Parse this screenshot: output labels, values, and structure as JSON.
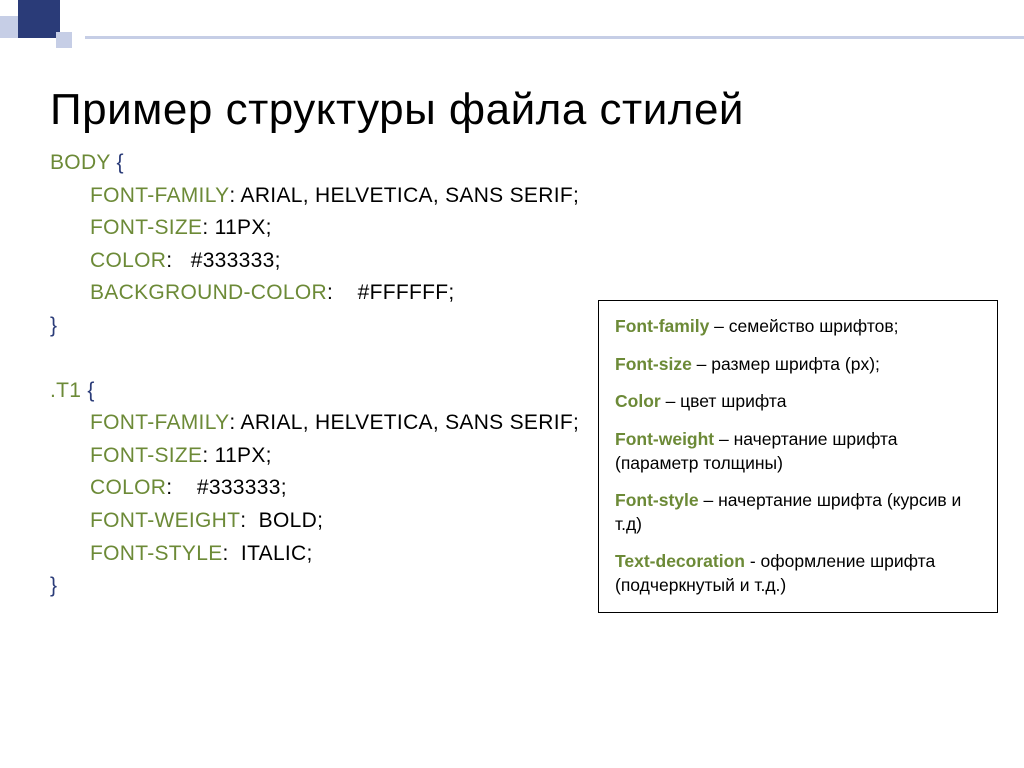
{
  "title": "Пример структуры файла стилей",
  "code": {
    "b1_sel": "Body",
    "b1_p1": "font-family",
    "b1_v1": ": Arial, Helvetica, sans serif;",
    "b1_p2": "font-size",
    "b1_v2": ": 11px;",
    "b1_p3": "color",
    "b1_v3": ":   #333333;",
    "b1_p4": "background-color",
    "b1_v4": ":    #FFFFFF;",
    "b2_sel": ".T1",
    "b2_p1": "font-family",
    "b2_v1": ": Arial, Helvetica, sans serif;",
    "b2_p2": "font-size",
    "b2_v2": ": 11px;",
    "b2_p3": "color",
    "b2_v3": ":    #333333;",
    "b2_p4": "font-weight",
    "b2_v4": ":  Bold;",
    "b2_p5": "font-style",
    "b2_v5": ":  Italic;",
    "open": " {",
    "close": "}"
  },
  "legend": [
    {
      "term": "Font-family",
      "desc": " – семейство шрифтов;"
    },
    {
      "term": "Font-size",
      "desc": " – размер шрифта (px);"
    },
    {
      "term": "Color",
      "desc": " – цвет шрифта"
    },
    {
      "term": "Font-weight",
      "desc": " – начертание шрифта (параметр толщины)"
    },
    {
      "term": "Font-style",
      "desc": " – начертание шрифта (курсив и т.д)"
    },
    {
      "term": "Text-decoration",
      "desc": "  - оформление шрифта (подчеркнутый и т.д.)"
    }
  ]
}
